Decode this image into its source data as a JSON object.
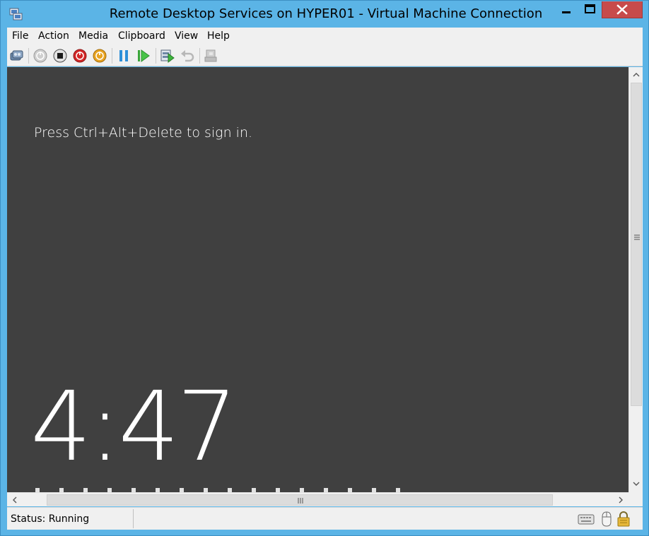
{
  "window": {
    "title": "Remote Desktop Services on HYPER01 - Virtual Machine Connection",
    "app_icon": "vm-connection-icon",
    "controls": [
      "minimize-icon",
      "maximize-icon",
      "close-icon"
    ]
  },
  "menu": {
    "items": [
      {
        "label": "File"
      },
      {
        "label": "Action"
      },
      {
        "label": "Media"
      },
      {
        "label": "Clipboard"
      },
      {
        "label": "View"
      },
      {
        "label": "Help"
      }
    ]
  },
  "toolbar": {
    "buttons": [
      "ctrl-alt-del-icon",
      "start-icon",
      "turn-off-icon",
      "shutdown-icon",
      "save-icon",
      "pause-icon",
      "resume-icon",
      "checkpoint-icon",
      "revert-icon",
      "enhanced-session-icon"
    ]
  },
  "vm_screen": {
    "prompt": "Press Ctrl+Alt+Delete to sign in.",
    "clock": "4:47",
    "background": "#404040"
  },
  "status": {
    "text": "Status: Running",
    "icons": [
      "keyboard-icon",
      "mouse-icon",
      "lock-icon"
    ]
  },
  "colors": {
    "title_bar": "#5bb4e6",
    "close_button": "#c74b4b",
    "chrome": "#f0f0f0"
  }
}
